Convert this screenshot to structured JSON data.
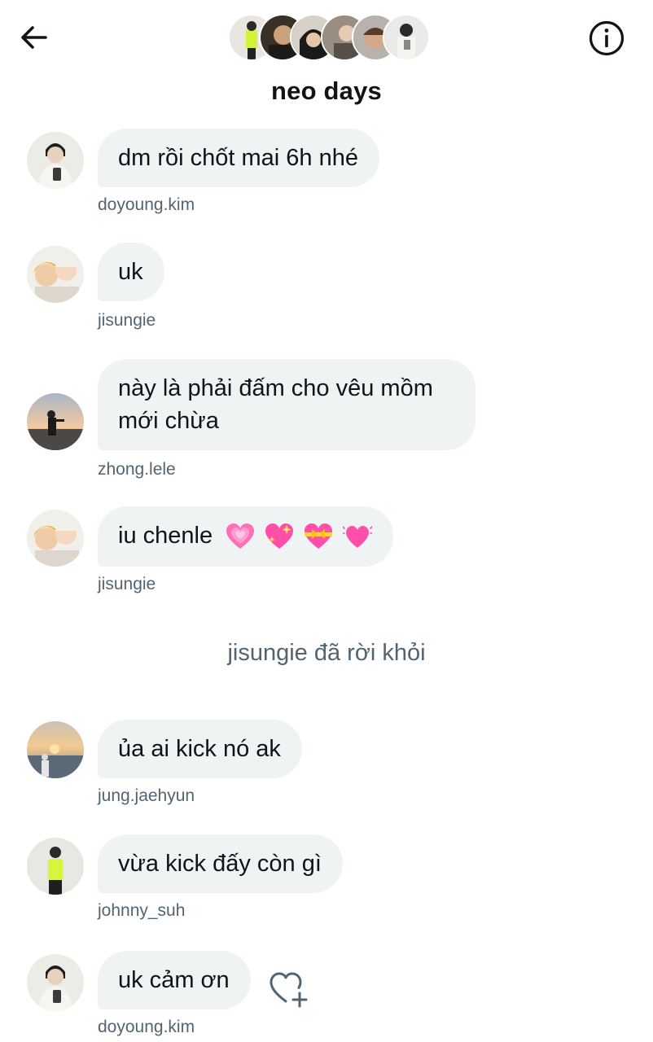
{
  "header": {
    "title": "neo days",
    "back_icon": "arrow-left-icon",
    "info_icon": "info-circle-icon",
    "member_avatars": [
      "member-1",
      "member-2",
      "member-3",
      "member-4",
      "member-5",
      "member-6"
    ]
  },
  "messages": [
    {
      "username": "doyoung.kim",
      "text": "dm rồi chốt mai 6h nhé"
    },
    {
      "username": "jisungie",
      "text": "uk"
    },
    {
      "username": "zhong.lele",
      "text": "này là phải đấm cho vêu mồm mới chừa"
    },
    {
      "username": "jisungie",
      "text": "iu chenle",
      "emojis": [
        "growing-heart",
        "sparkling-heart",
        "heart-with-ribbon",
        "beating-heart"
      ]
    },
    {
      "username": "jung.jaehyun",
      "text": "ủa ai kick nó ak"
    },
    {
      "username": "johnny_suh",
      "text": "vừa kick đấy còn gì"
    },
    {
      "username": "doyoung.kim",
      "text": "uk cảm ơn"
    }
  ],
  "system": {
    "left_text": "jisungie đã rời khỏi"
  },
  "reaction": {
    "icon": "heart-add-icon"
  },
  "colors": {
    "bubble": "#eff3f4",
    "text": "#0f1419",
    "secondary": "#536471",
    "emoji_pink": "#ff5fb5"
  }
}
